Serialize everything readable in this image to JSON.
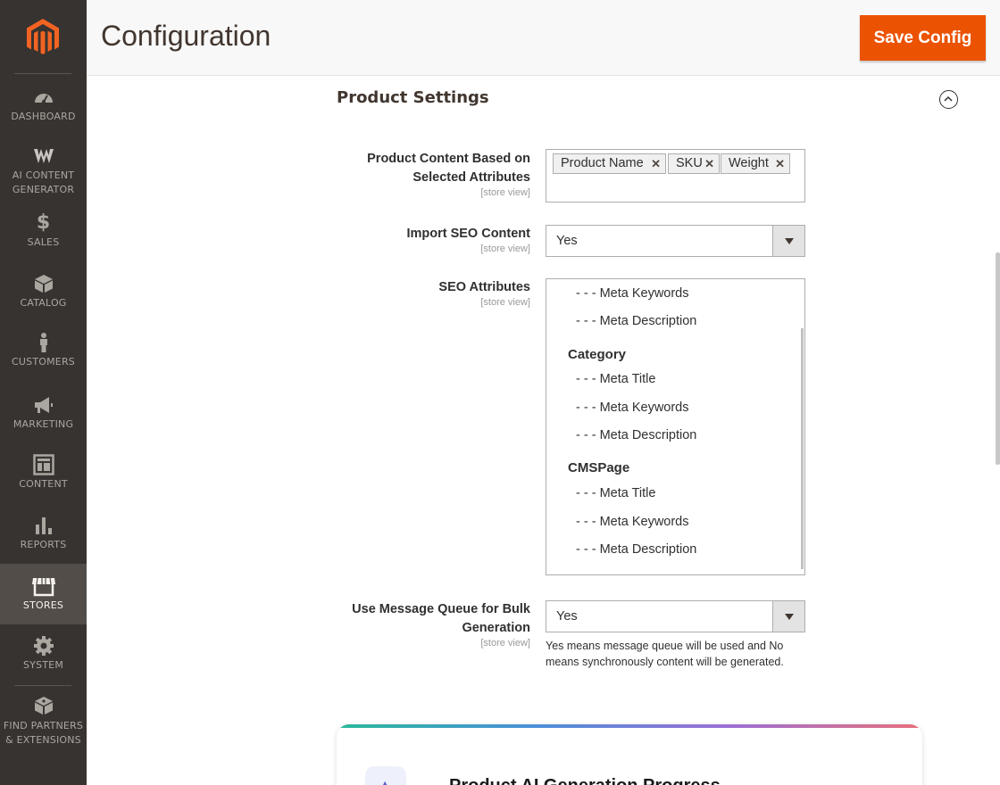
{
  "sidebar": {
    "items": [
      {
        "label": "DASHBOARD",
        "icon": "dashboard-icon"
      },
      {
        "label": "AI CONTENT GENERATOR",
        "icon": "ai-logo-icon"
      },
      {
        "label": "SALES",
        "icon": "dollar-icon"
      },
      {
        "label": "CATALOG",
        "icon": "box-icon"
      },
      {
        "label": "CUSTOMERS",
        "icon": "person-icon"
      },
      {
        "label": "MARKETING",
        "icon": "megaphone-icon"
      },
      {
        "label": "CONTENT",
        "icon": "layout-icon"
      },
      {
        "label": "REPORTS",
        "icon": "bar-chart-icon"
      },
      {
        "label": "STORES",
        "icon": "storefront-icon",
        "active": true
      },
      {
        "label": "SYSTEM",
        "icon": "gear-icon"
      },
      {
        "label": "FIND PARTNERS & EXTENSIONS",
        "icon": "blocks-icon"
      }
    ],
    "ai_line1": "AI CONTENT",
    "ai_line2": "GENERATOR",
    "partners_line1": "FIND PARTNERS",
    "partners_line2": "& EXTENSIONS"
  },
  "header": {
    "title": "Configuration",
    "save_label": "Save Config"
  },
  "section": {
    "title": "Product Settings"
  },
  "fields": {
    "product_content": {
      "label_line1": "Product Content Based on",
      "label_line2": "Selected Attributes",
      "scope": "[store view]",
      "tags": [
        "Product Name",
        "SKU",
        "Weight"
      ]
    },
    "import_seo": {
      "label": "Import SEO Content",
      "scope": "[store view]",
      "value": "Yes"
    },
    "seo_attributes": {
      "label": "SEO Attributes",
      "scope": "[store view]",
      "options": [
        {
          "text": "- - - Meta Keywords"
        },
        {
          "text": "- - - Meta Description"
        },
        {
          "group": "Category"
        },
        {
          "text": "- - - Meta Title"
        },
        {
          "text": "- - - Meta Keywords"
        },
        {
          "text": "- - - Meta Description"
        },
        {
          "group": "CMSPage"
        },
        {
          "text": "- - - Meta Title"
        },
        {
          "text": "- - - Meta Keywords"
        },
        {
          "text": "- - - Meta Description"
        }
      ]
    },
    "message_queue": {
      "label_line1": "Use Message Queue for Bulk",
      "label_line2": "Generation",
      "scope": "[store view]",
      "value": "Yes",
      "note": "Yes means message queue will be used and No means synchronously content will be generated."
    }
  },
  "progress_card": {
    "title": "Product AI Generation Progress"
  },
  "colors": {
    "sidebar_bg": "#373330",
    "accent": "#eb5202",
    "active_nav": "#524d49"
  }
}
